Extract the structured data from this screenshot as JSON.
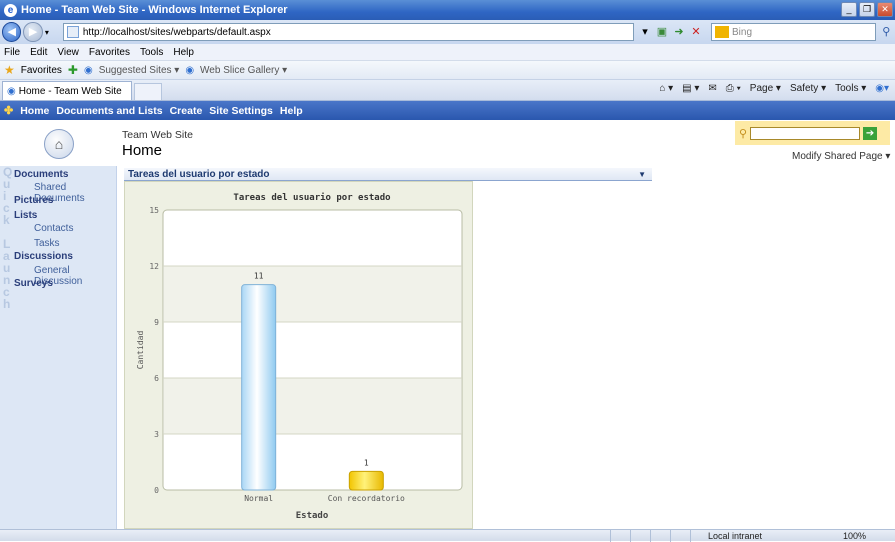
{
  "window": {
    "title": "Home - Team Web Site - Windows Internet Explorer",
    "address": "http://localhost/sites/webparts/default.aspx",
    "search_placeholder": "Bing",
    "menu": [
      "File",
      "Edit",
      "View",
      "Favorites",
      "Tools",
      "Help"
    ],
    "favorites": {
      "label": "Favorites",
      "suggested": "Suggested Sites ▾",
      "gallery": "Web Slice Gallery ▾"
    },
    "tab": "Home - Team Web Site",
    "commands": [
      "Page ▾",
      "Safety ▾",
      "Tools ▾"
    ],
    "status": {
      "zone": "Local intranet",
      "zoom": "100%"
    }
  },
  "sharepoint": {
    "topnav": [
      "Home",
      "Documents and Lists",
      "Create",
      "Site Settings",
      "Help"
    ],
    "site_title": "Team Web Site",
    "page_title": "Home",
    "modify_page": "Modify Shared Page ▾",
    "quick_launch": [
      {
        "label": "Documents",
        "type": "heading"
      },
      {
        "label": "Shared Documents",
        "type": "sub"
      },
      {
        "label": "Pictures",
        "type": "heading"
      },
      {
        "label": "Lists",
        "type": "heading"
      },
      {
        "label": "Contacts",
        "type": "sub"
      },
      {
        "label": "Tasks",
        "type": "sub"
      },
      {
        "label": "Discussions",
        "type": "heading"
      },
      {
        "label": "General Discussion",
        "type": "sub"
      },
      {
        "label": "Surveys",
        "type": "heading"
      }
    ],
    "webpart_title": "Tareas del usuario por estado"
  },
  "chart_data": {
    "type": "bar",
    "title": "Tareas del usuario por estado",
    "categories": [
      "Normal",
      "Con recordatorio"
    ],
    "values": [
      11,
      1
    ],
    "colors": [
      "#c9e8fb",
      "#f6d21d"
    ],
    "xlabel": "Estado",
    "ylabel": "Cantidad",
    "ylim": [
      0,
      15
    ],
    "yticks": [
      0,
      3,
      6,
      9,
      12,
      15
    ]
  }
}
